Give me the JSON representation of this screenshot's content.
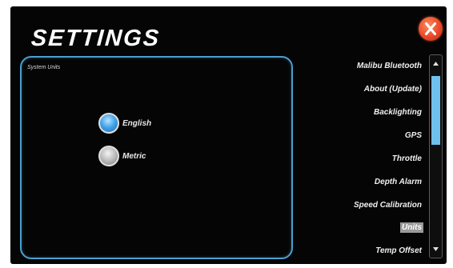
{
  "page": {
    "title": "SETTINGS"
  },
  "close_button": {
    "icon": "close-icon",
    "color": "#e8482a"
  },
  "units_panel": {
    "label": "System Units",
    "options": [
      {
        "label": "English",
        "selected": true
      },
      {
        "label": "Metric",
        "selected": false
      }
    ],
    "border_color": "#4a9fd0"
  },
  "menu": {
    "items": [
      {
        "label": "Malibu Bluetooth",
        "selected": false
      },
      {
        "label": "About (Update)",
        "selected": false
      },
      {
        "label": "Backlighting",
        "selected": false
      },
      {
        "label": "GPS",
        "selected": false
      },
      {
        "label": "Throttle",
        "selected": false
      },
      {
        "label": "Depth Alarm",
        "selected": false
      },
      {
        "label": "Speed Calibration",
        "selected": false
      },
      {
        "label": "Units",
        "selected": true
      },
      {
        "label": "Temp Offset",
        "selected": false
      }
    ]
  },
  "scrollbar": {
    "thumb_color": "#6fc0ec",
    "up_icon": "caret-up-icon",
    "down_icon": "caret-down-icon"
  }
}
